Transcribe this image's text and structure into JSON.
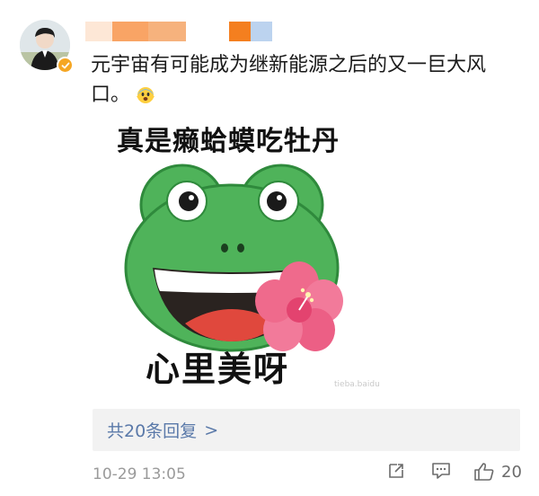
{
  "comment": {
    "text": "元宇宙有可能成为继新能源之后的又一巨大风口。",
    "emoji": "scared-face-emoji"
  },
  "sticker": {
    "top_caption": "真是癞蛤蟆吃牡丹",
    "bottom_caption": "心里美呀",
    "watermark": "tieba.baidu"
  },
  "replies": {
    "label": "共20条回复",
    "chevron": ">"
  },
  "meta": {
    "timestamp": "10-29 13:05",
    "like_count": "20"
  },
  "colors": {
    "link": "#5a79a9",
    "name_redaction_1": "#fde1cc",
    "name_redaction_2": "#f9a465",
    "name_redaction_3": "#f47f1f",
    "name_redaction_4": "#bcd3ef",
    "verified_badge": "#f5a623",
    "frog_green": "#4fb35a"
  }
}
